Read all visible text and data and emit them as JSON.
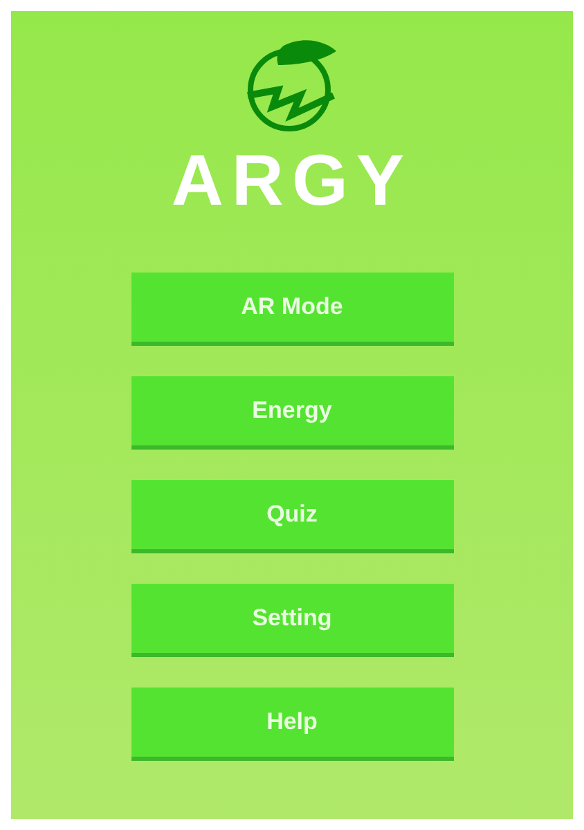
{
  "logo": {
    "title": "ARGY"
  },
  "menu": [
    {
      "label": "AR Mode"
    },
    {
      "label": "Energy"
    },
    {
      "label": "Quiz"
    },
    {
      "label": "Setting"
    },
    {
      "label": "Help"
    }
  ]
}
